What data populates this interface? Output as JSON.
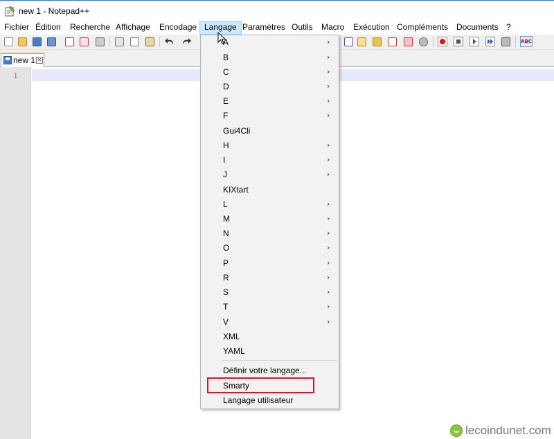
{
  "window": {
    "title": "new 1 - Notepad++"
  },
  "menubar": {
    "items": [
      "Fichier",
      "Édition",
      "Recherche",
      "Affichage",
      "Encodage",
      "Langage",
      "Paramètres",
      "Outils",
      "Macro",
      "Exécution",
      "Compléments",
      "Documents",
      "?"
    ],
    "active": "Langage"
  },
  "tab": {
    "label": "new 1",
    "close_glyph": "×"
  },
  "editor": {
    "line_number": "1"
  },
  "language_menu": {
    "items": [
      {
        "label": "A",
        "submenu": true
      },
      {
        "label": "B",
        "submenu": true
      },
      {
        "label": "C",
        "submenu": true
      },
      {
        "label": "D",
        "submenu": true
      },
      {
        "label": "E",
        "submenu": true
      },
      {
        "label": "F",
        "submenu": true
      },
      {
        "label": "Gui4Cli",
        "submenu": false
      },
      {
        "label": "H",
        "submenu": true
      },
      {
        "label": "I",
        "submenu": true
      },
      {
        "label": "J",
        "submenu": true
      },
      {
        "label": "KIXtart",
        "submenu": false
      },
      {
        "label": "L",
        "submenu": true
      },
      {
        "label": "M",
        "submenu": true
      },
      {
        "label": "N",
        "submenu": true
      },
      {
        "label": "O",
        "submenu": true
      },
      {
        "label": "P",
        "submenu": true
      },
      {
        "label": "R",
        "submenu": true
      },
      {
        "label": "S",
        "submenu": true
      },
      {
        "label": "T",
        "submenu": true
      },
      {
        "label": "V",
        "submenu": true
      },
      {
        "label": "XML",
        "submenu": false
      },
      {
        "label": "YAML",
        "submenu": false
      }
    ],
    "extra_items": [
      "Définir votre langage...",
      "Smarty",
      "Langage utilisateur"
    ],
    "highlighted_item": "Smarty",
    "submenu_arrow": "›"
  },
  "watermark": {
    "text": "lecoindunet.com"
  },
  "colors": {
    "highlight": "#e0102a",
    "menu_active": "#cce8ff",
    "tab_accent": "#f9a83f"
  }
}
